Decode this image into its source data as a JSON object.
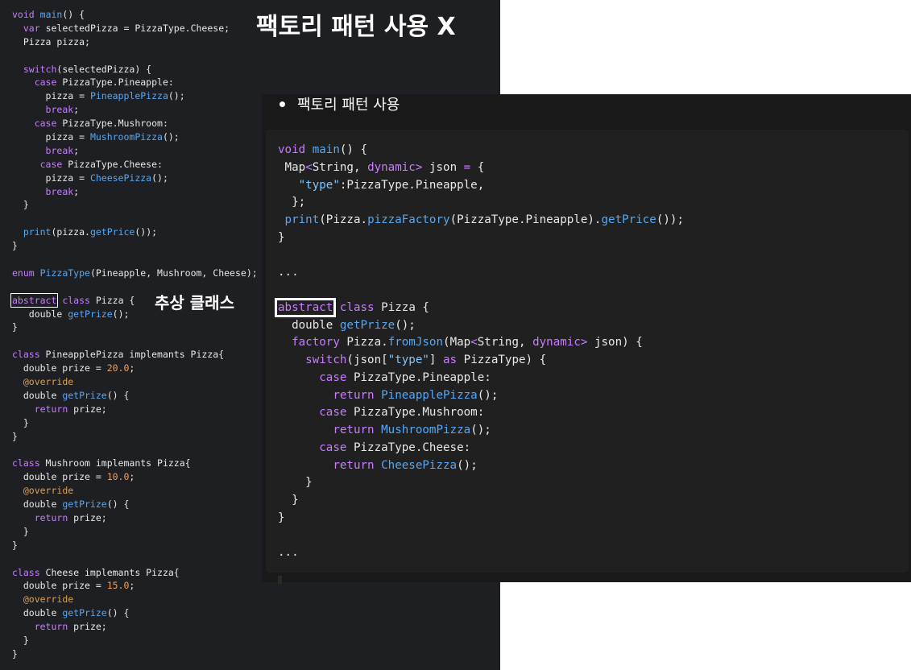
{
  "left": {
    "title": "팩토리 패턴 사용 X",
    "annotation": "추상 클래스",
    "lines": [
      [
        [
          "kw",
          "void"
        ],
        [
          "pl",
          " "
        ],
        [
          "fn",
          "main"
        ],
        [
          "pl",
          "() {"
        ]
      ],
      [
        [
          "pl",
          "  "
        ],
        [
          "kw",
          "var"
        ],
        [
          "pl",
          " selectedPizza = PizzaType.Cheese;"
        ]
      ],
      [
        [
          "pl",
          "  Pizza pizza;"
        ]
      ],
      [
        [
          "pl",
          ""
        ]
      ],
      [
        [
          "pl",
          "  "
        ],
        [
          "kw",
          "switch"
        ],
        [
          "pl",
          "(selectedPizza) {"
        ]
      ],
      [
        [
          "pl",
          "    "
        ],
        [
          "kw",
          "case"
        ],
        [
          "pl",
          " PizzaType.Pineapple:"
        ]
      ],
      [
        [
          "pl",
          "      pizza = "
        ],
        [
          "fn",
          "PineapplePizza"
        ],
        [
          "pl",
          "();"
        ]
      ],
      [
        [
          "pl",
          "      "
        ],
        [
          "kw",
          "break"
        ],
        [
          "pl",
          ";"
        ]
      ],
      [
        [
          "pl",
          "    "
        ],
        [
          "kw",
          "case"
        ],
        [
          "pl",
          " PizzaType.Mushroom:"
        ]
      ],
      [
        [
          "pl",
          "      pizza = "
        ],
        [
          "fn",
          "MushroomPizza"
        ],
        [
          "pl",
          "();"
        ]
      ],
      [
        [
          "pl",
          "      "
        ],
        [
          "kw",
          "break"
        ],
        [
          "pl",
          ";"
        ]
      ],
      [
        [
          "pl",
          "     "
        ],
        [
          "kw",
          "case"
        ],
        [
          "pl",
          " PizzaType.Cheese:"
        ]
      ],
      [
        [
          "pl",
          "      pizza = "
        ],
        [
          "fn",
          "CheesePizza"
        ],
        [
          "pl",
          "();"
        ]
      ],
      [
        [
          "pl",
          "      "
        ],
        [
          "kw",
          "break"
        ],
        [
          "pl",
          ";"
        ]
      ],
      [
        [
          "pl",
          "  }"
        ]
      ],
      [
        [
          "pl",
          ""
        ]
      ],
      [
        [
          "pl",
          "  "
        ],
        [
          "fn",
          "print"
        ],
        [
          "pl",
          "(pizza."
        ],
        [
          "fn",
          "getPrice"
        ],
        [
          "pl",
          "());"
        ]
      ],
      [
        [
          "pl",
          "}"
        ]
      ],
      [
        [
          "pl",
          ""
        ]
      ],
      [
        [
          "kw",
          "enum"
        ],
        [
          "pl",
          " "
        ],
        [
          "fn",
          "PizzaType"
        ],
        [
          "pl",
          "(Pineapple, Mushroom, Cheese);"
        ]
      ],
      [
        [
          "pl",
          ""
        ]
      ],
      [
        [
          "box",
          "abstract"
        ],
        [
          "pl",
          " "
        ],
        [
          "kw",
          "class"
        ],
        [
          "pl",
          " Pizza {"
        ]
      ],
      [
        [
          "pl",
          "   double "
        ],
        [
          "fn",
          "getPrize"
        ],
        [
          "pl",
          "();"
        ]
      ],
      [
        [
          "pl",
          "}"
        ]
      ],
      [
        [
          "pl",
          ""
        ]
      ],
      [
        [
          "kw",
          "class"
        ],
        [
          "pl",
          " PineapplePizza implemants Pizza{"
        ]
      ],
      [
        [
          "pl",
          "  double prize = "
        ],
        [
          "num",
          "20.0"
        ],
        [
          "pl",
          ";"
        ]
      ],
      [
        [
          "pl",
          "  "
        ],
        [
          "an",
          "@override"
        ]
      ],
      [
        [
          "pl",
          "  double "
        ],
        [
          "fn",
          "getPrize"
        ],
        [
          "pl",
          "() {"
        ]
      ],
      [
        [
          "pl",
          "    "
        ],
        [
          "kw",
          "return"
        ],
        [
          "pl",
          " prize;"
        ]
      ],
      [
        [
          "pl",
          "  }"
        ]
      ],
      [
        [
          "pl",
          "}"
        ]
      ],
      [
        [
          "pl",
          ""
        ]
      ],
      [
        [
          "kw",
          "class"
        ],
        [
          "pl",
          " Mushroom implemants Pizza{"
        ]
      ],
      [
        [
          "pl",
          "  double prize = "
        ],
        [
          "num",
          "10.0"
        ],
        [
          "pl",
          ";"
        ]
      ],
      [
        [
          "pl",
          "  "
        ],
        [
          "an",
          "@override"
        ]
      ],
      [
        [
          "pl",
          "  double "
        ],
        [
          "fn",
          "getPrize"
        ],
        [
          "pl",
          "() {"
        ]
      ],
      [
        [
          "pl",
          "    "
        ],
        [
          "kw",
          "return"
        ],
        [
          "pl",
          " prize;"
        ]
      ],
      [
        [
          "pl",
          "  }"
        ]
      ],
      [
        [
          "pl",
          "}"
        ]
      ],
      [
        [
          "pl",
          ""
        ]
      ],
      [
        [
          "kw",
          "class"
        ],
        [
          "pl",
          " Cheese implemants Pizza{"
        ]
      ],
      [
        [
          "pl",
          "  double prize = "
        ],
        [
          "num",
          "15.0"
        ],
        [
          "pl",
          ";"
        ]
      ],
      [
        [
          "pl",
          "  "
        ],
        [
          "an",
          "@override"
        ]
      ],
      [
        [
          "pl",
          "  double "
        ],
        [
          "fn",
          "getPrize"
        ],
        [
          "pl",
          "() {"
        ]
      ],
      [
        [
          "pl",
          "    "
        ],
        [
          "kw",
          "return"
        ],
        [
          "pl",
          " prize;"
        ]
      ],
      [
        [
          "pl",
          "  }"
        ]
      ],
      [
        [
          "pl",
          "}"
        ]
      ]
    ]
  },
  "right": {
    "bullet": "팩토리 패턴 사용",
    "lines": [
      [
        [
          "kw",
          "void"
        ],
        [
          "pl",
          " "
        ],
        [
          "fn",
          "main"
        ],
        [
          "pl",
          "() {"
        ]
      ],
      [
        [
          "pl",
          " Map"
        ],
        [
          "kw",
          "<"
        ],
        [
          "pl",
          "String, "
        ],
        [
          "kw",
          "dynamic"
        ],
        [
          "kw",
          ">"
        ],
        [
          "pl",
          " json "
        ],
        [
          "kw",
          "="
        ],
        [
          "pl",
          " {"
        ]
      ],
      [
        [
          "pl",
          "   "
        ],
        [
          "str",
          "\"type\""
        ],
        [
          "pl",
          ":PizzaType.Pineapple,"
        ]
      ],
      [
        [
          "pl",
          "  };"
        ]
      ],
      [
        [
          "pl",
          " "
        ],
        [
          "fn",
          "print"
        ],
        [
          "pl",
          "(Pizza."
        ],
        [
          "fn",
          "pizzaFactory"
        ],
        [
          "pl",
          "(PizzaType.Pineapple)."
        ],
        [
          "fn",
          "getPrice"
        ],
        [
          "pl",
          "());"
        ]
      ],
      [
        [
          "pl",
          "}"
        ]
      ],
      [
        [
          "pl",
          ""
        ]
      ],
      [
        [
          "pl",
          "..."
        ]
      ],
      [
        [
          "pl",
          ""
        ]
      ],
      [
        [
          "box",
          "abstract"
        ],
        [
          "pl",
          " "
        ],
        [
          "kw",
          "class"
        ],
        [
          "pl",
          " Pizza {"
        ]
      ],
      [
        [
          "pl",
          "  double "
        ],
        [
          "fn",
          "getPrize"
        ],
        [
          "pl",
          "();"
        ]
      ],
      [
        [
          "pl",
          "  "
        ],
        [
          "kw",
          "factory"
        ],
        [
          "pl",
          " Pizza."
        ],
        [
          "fn",
          "fromJson"
        ],
        [
          "pl",
          "(Map"
        ],
        [
          "kw",
          "<"
        ],
        [
          "pl",
          "String, "
        ],
        [
          "kw",
          "dynamic"
        ],
        [
          "kw",
          ">"
        ],
        [
          "pl",
          " json) {"
        ]
      ],
      [
        [
          "pl",
          "    "
        ],
        [
          "kw",
          "switch"
        ],
        [
          "pl",
          "(json["
        ],
        [
          "str",
          "\"type\""
        ],
        [
          "pl",
          "] "
        ],
        [
          "kw",
          "as"
        ],
        [
          "pl",
          " PizzaType) {"
        ]
      ],
      [
        [
          "pl",
          "      "
        ],
        [
          "kw",
          "case"
        ],
        [
          "pl",
          " PizzaType.Pineapple:"
        ]
      ],
      [
        [
          "pl",
          "        "
        ],
        [
          "kw",
          "return"
        ],
        [
          "pl",
          " "
        ],
        [
          "fn",
          "PineapplePizza"
        ],
        [
          "pl",
          "();"
        ]
      ],
      [
        [
          "pl",
          "      "
        ],
        [
          "kw",
          "case"
        ],
        [
          "pl",
          " PizzaType.Mushroom:"
        ]
      ],
      [
        [
          "pl",
          "        "
        ],
        [
          "kw",
          "return"
        ],
        [
          "pl",
          " "
        ],
        [
          "fn",
          "MushroomPizza"
        ],
        [
          "pl",
          "();"
        ]
      ],
      [
        [
          "pl",
          "      "
        ],
        [
          "kw",
          "case"
        ],
        [
          "pl",
          " PizzaType.Cheese:"
        ]
      ],
      [
        [
          "pl",
          "        "
        ],
        [
          "kw",
          "return"
        ],
        [
          "pl",
          " "
        ],
        [
          "fn",
          "CheesePizza"
        ],
        [
          "pl",
          "();"
        ]
      ],
      [
        [
          "pl",
          "    }"
        ]
      ],
      [
        [
          "pl",
          "  }"
        ]
      ],
      [
        [
          "pl",
          "}"
        ]
      ],
      [
        [
          "pl",
          ""
        ]
      ],
      [
        [
          "pl",
          "..."
        ]
      ]
    ]
  }
}
